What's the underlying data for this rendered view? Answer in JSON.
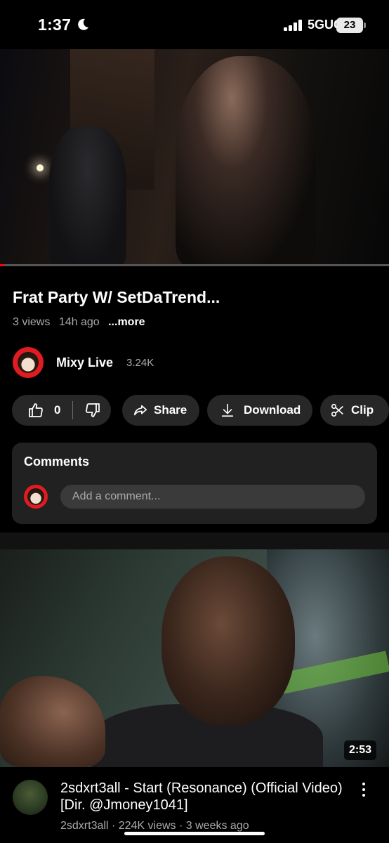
{
  "status": {
    "time": "1:37",
    "network": "5GUC",
    "battery": "23"
  },
  "player": {
    "progress": 0.01
  },
  "video": {
    "title": "Frat Party W/ SetDaTrend...",
    "views": "3 views",
    "age": "14h ago",
    "more": "...more"
  },
  "channel": {
    "name": "Mixy Live",
    "subscribers": "3.24K"
  },
  "actions": {
    "likes": "0",
    "share": "Share",
    "download": "Download",
    "clip": "Clip"
  },
  "comments": {
    "title": "Comments",
    "placeholder": "Add a comment..."
  },
  "recommended": {
    "duration": "2:53",
    "title": "2sdxrt3all - Start (Resonance) (Official Video) [Dir. @Jmoney1041]",
    "channel": "2sdxrt3all",
    "views": "224K views",
    "age": "3 weeks ago"
  },
  "colors": {
    "accent": "#ff0000",
    "avatar_ring": "#e11b22",
    "pill": "#272727",
    "card": "#212121"
  }
}
